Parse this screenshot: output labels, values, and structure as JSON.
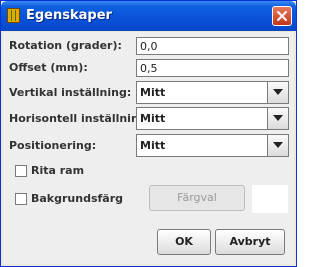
{
  "window": {
    "title": "Egenskaper",
    "icon": "grid-icon"
  },
  "form": {
    "rotation": {
      "label": "Rotation (grader):",
      "value": "0,0"
    },
    "offset": {
      "label": "Offset (mm):",
      "value": "0,5"
    },
    "vertical": {
      "label": "Vertikal inställning:",
      "value": "Mitt"
    },
    "horizontal": {
      "label": "Horisontell inställning:",
      "value": "Mitt"
    },
    "positioning": {
      "label": "Positionering:",
      "value": "Mitt"
    },
    "draw_frame": {
      "label": "Rita ram",
      "checked": false
    },
    "background": {
      "label": "Bakgrundsfärg",
      "checked": false,
      "color_button": "Färgval"
    }
  },
  "buttons": {
    "ok": "OK",
    "cancel": "Avbryt"
  }
}
